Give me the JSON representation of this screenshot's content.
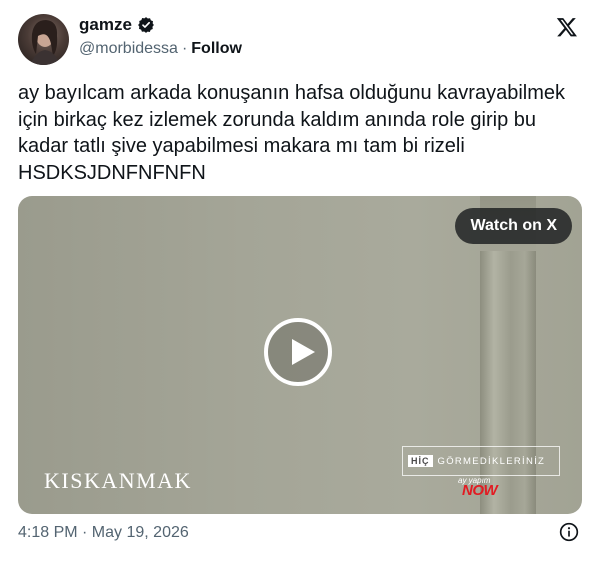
{
  "author": {
    "display_name": "gamze",
    "handle": "@morbidessa",
    "separator": "·",
    "follow_label": "Follow",
    "verified_icon": "verified-badge-icon",
    "verified_color": "#0f1419"
  },
  "tweet": {
    "text": "ay bayılcam arkada konuşanın hafsa olduğunu kavrayabilmek için birkaç kez izlemek zorunda kaldım anında role girip bu kadar tatlı şive yapabilmesi makara mı tam bi rizeli HSDKSJDNFNFNFN"
  },
  "media": {
    "watch_label": "Watch on X",
    "play_icon": "play-icon",
    "show_title": "KISKANMAK",
    "badge_hic": "HİÇ",
    "badge_text": "GÖRMEDİKLERİNİZ",
    "badge_sub": "ay yapım",
    "network_logo": "NOW",
    "network_color": "#e21b22"
  },
  "footer": {
    "timestamp": "4:18 PM · May 19, 2026",
    "info_icon": "info-icon"
  },
  "brand": {
    "logo_icon": "x-logo-icon"
  }
}
